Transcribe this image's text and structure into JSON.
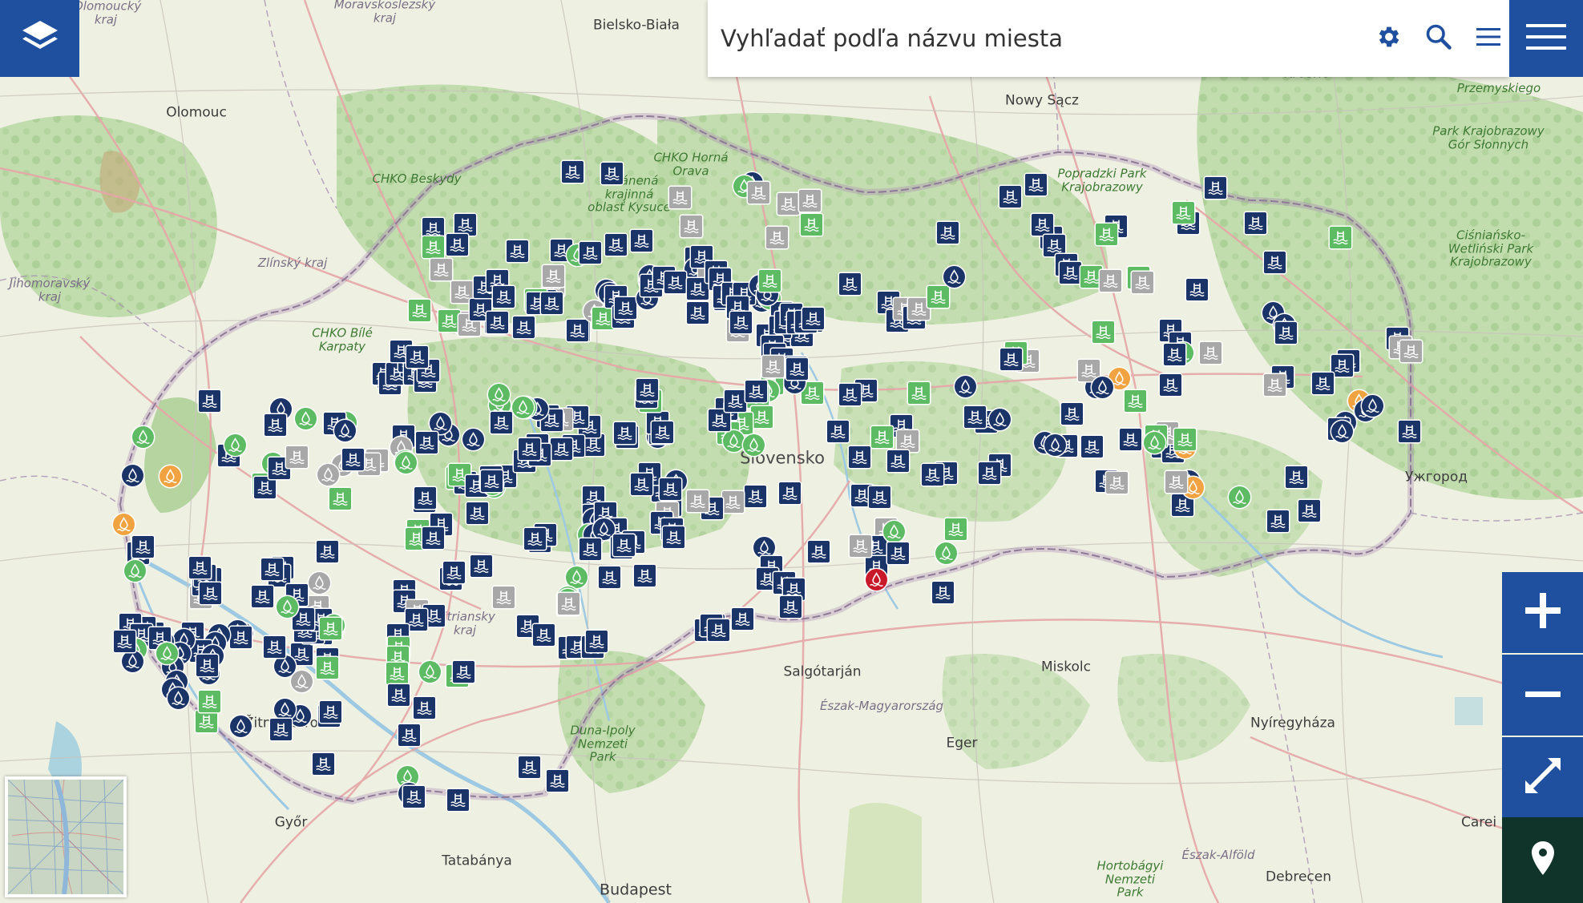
{
  "search": {
    "placeholder": "Vyhľadať podľa názvu miesta"
  },
  "icons": {
    "layers": "layers-icon",
    "settings": "gear-icon",
    "search": "search-icon",
    "list": "list-icon",
    "menu": "hamburger-menu-icon",
    "zoom_in": "plus-icon",
    "zoom_out": "minus-icon",
    "fullscreen": "fullscreen-icon",
    "locate": "map-pin-icon"
  },
  "colors": {
    "control_blue": "#1f4f9f",
    "marker_navy": "#1b3468",
    "marker_green": "#5dbb63",
    "marker_grey": "#a8a8a8",
    "marker_orange": "#f2a341",
    "marker_red": "#c8192b",
    "locate_bg": "#10342a"
  },
  "map_labels": {
    "olomoucky": "Olomoucký kraj",
    "moravskoslezsky": "Moravskoslezský kraj",
    "bielsko": "Bielsko-Biała",
    "olomouc": "Olomouc",
    "nowy_sacz": "Nowy Sącz",
    "krosno": "Krosno",
    "przemyskiego": "Przemyskiego",
    "pk_gor": "Park Krajobrazowy Gór Słonnych",
    "chko_beskydy": "CHKO Beskydy",
    "chko_orava": "CHKO Horná Orava",
    "kysuce": "Chránená krajinná oblasť Kysuce",
    "poprad": "Popradzki Park Krajobrazowy",
    "cis": "Ciśniańsko-Wetliński Park Krajobrazowy",
    "zlinsky": "Zlínský kraj",
    "jihomoravsky": "Jihomoravský kraj",
    "chko_bile": "CHKO Bílé Karpaty",
    "slovensko": "Slovensko",
    "uzhorod": "Ужгород",
    "salgotarjan": "Salgótarján",
    "miskolc": "Miskolc",
    "eszak": "Észak-Magyarország",
    "nyiregyhaza": "Nyíregyháza",
    "nitriansky": "Nitriansky kraj",
    "duna": "Duna-Ipoly Nemzeti Park",
    "eger": "Eger",
    "gyor": "Győr",
    "tatabanya": "Tatabánya",
    "budapest": "Budapest",
    "hortobagy": "Hortobágyi Nemzeti Park",
    "eszak_alfold": "Észak-Alföld",
    "debrecen": "Debrecen",
    "carei": "Carei",
    "zitny": "Žitný ostrov"
  }
}
